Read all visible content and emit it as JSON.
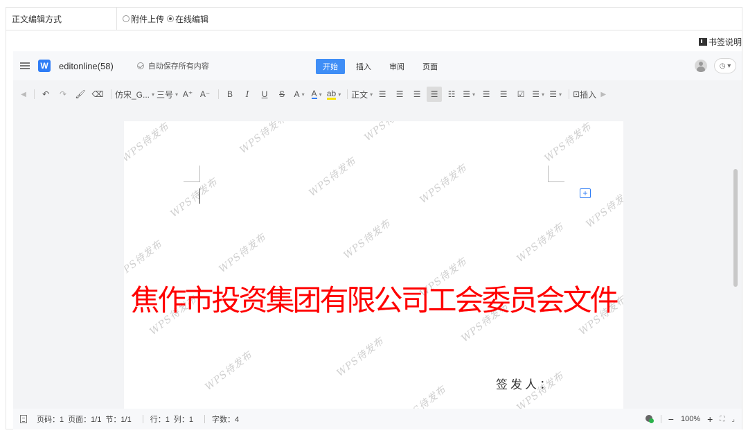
{
  "form": {
    "label": "正文编辑方式",
    "options": [
      {
        "label": "附件上传",
        "checked": false
      },
      {
        "label": "在线编辑",
        "checked": true
      }
    ]
  },
  "bookmark": {
    "label": "书签说明"
  },
  "editor": {
    "doc_name": "editonline(58)",
    "autosave": "自动保存所有内容",
    "tabs": [
      "开始",
      "插入",
      "审阅",
      "页面"
    ],
    "active_tab": "开始",
    "toolbar": {
      "font_name": "仿宋_G...",
      "font_size": "三号",
      "grow": "A⁺",
      "shrink": "A⁻",
      "bold": "B",
      "italic": "I",
      "underline": "U",
      "strike": "S",
      "superscript": "A",
      "font_color": "A",
      "highlight": "ab",
      "style": "正文",
      "insert": "插入"
    }
  },
  "document": {
    "title": "焦作市投资集团有限公司工会委员会文件",
    "signer_label": "签发人：",
    "watermark": "WPS待发布",
    "title_color": "#ff0000"
  },
  "statusbar": {
    "page_code": "页码：1",
    "pages": "页面：1/1",
    "section": "节：1/1",
    "row": "行：1",
    "col": "列：1",
    "word_count": "字数：4",
    "zoom": "100%"
  },
  "colors": {
    "accent": "#3f8ef6",
    "logo": "#2f7df6"
  }
}
